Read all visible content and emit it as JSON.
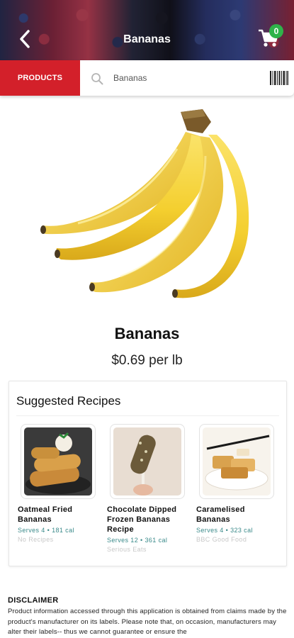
{
  "header": {
    "title": "Bananas",
    "cart_count": "0"
  },
  "search": {
    "products_label": "PRODUCTS",
    "value": "Bananas"
  },
  "product": {
    "name": "Bananas",
    "price": "$0.69 per lb"
  },
  "recipes": {
    "title": "Suggested Recipes",
    "items": [
      {
        "name": "Oatmeal Fried Bananas",
        "meta": "Serves 4 • 181 cal",
        "source": "No Recipes"
      },
      {
        "name": "Chocolate Dipped Frozen Bananas Recipe",
        "meta": "Serves 12 • 361 cal",
        "source": "Serious Eats"
      },
      {
        "name": "Caramelised Bananas",
        "meta": "Serves 4 • 323 cal",
        "source": "BBC Good Food"
      }
    ]
  },
  "disclaimer": {
    "title": "DISCLAIMER",
    "text": "Product information accessed through this application is obtained from claims made by the product's manufacturer on its labels. Please note that, on occasion, manufacturers may alter their labels-- thus we cannot guarantee or ensure the"
  },
  "colors": {
    "brand_red": "#d3202a",
    "badge_green": "#2fb34a",
    "meta_teal": "#3a8a8a"
  },
  "icons": [
    "back-icon",
    "cart-icon",
    "search-icon",
    "barcode-icon"
  ]
}
